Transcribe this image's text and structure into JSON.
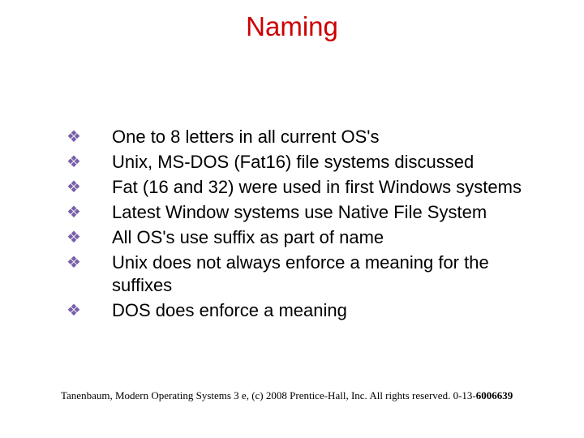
{
  "title": "Naming",
  "bullets": [
    "One to 8 letters in all current OS's",
    "Unix, MS-DOS (Fat16) file systems discussed",
    "Fat (16 and 32) were used in first Windows systems",
    "Latest Window systems use Native File System",
    "All OS's use suffix as part of name",
    "Unix does not always enforce a meaning for the suffixes",
    "DOS does enforce a meaning"
  ],
  "footer_prefix": "Tanenbaum, Modern Operating Systems 3 e, (c) 2008 Prentice-Hall, Inc. All rights reserved. 0-13-",
  "footer_bold": "6006639"
}
